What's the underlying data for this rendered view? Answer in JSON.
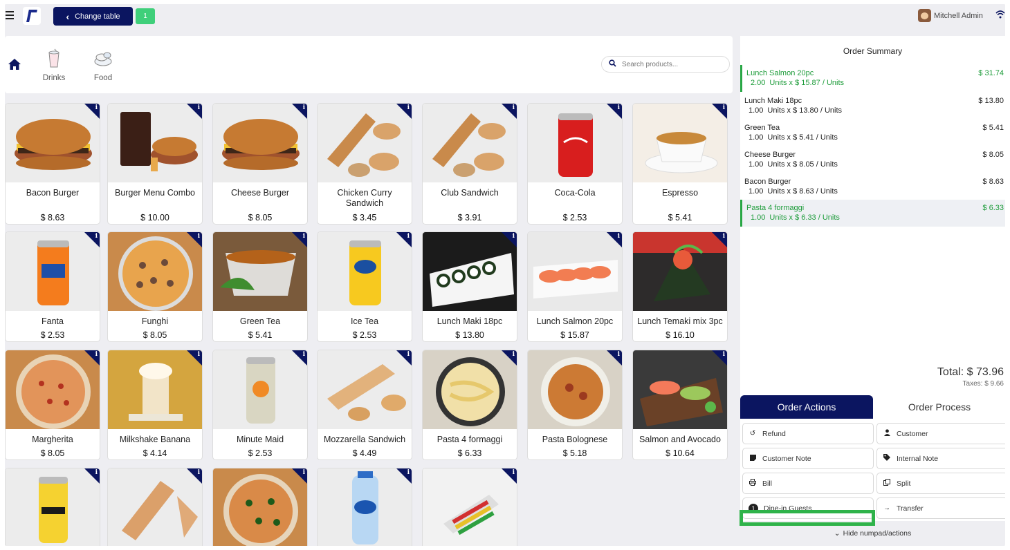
{
  "topbar": {
    "change_table_label": "Change table",
    "table_number": "1",
    "user_name": "Mitchell Admin"
  },
  "categories": [
    {
      "label": "Drinks"
    },
    {
      "label": "Food"
    }
  ],
  "search": {
    "placeholder": "Search products..."
  },
  "products": [
    {
      "name": "Bacon Burger",
      "price": "$ 8.63"
    },
    {
      "name": "Burger Menu Combo",
      "price": "$ 10.00"
    },
    {
      "name": "Cheese Burger",
      "price": "$ 8.05"
    },
    {
      "name": "Chicken Curry Sandwich",
      "price": "$ 3.45"
    },
    {
      "name": "Club Sandwich",
      "price": "$ 3.91"
    },
    {
      "name": "Coca-Cola",
      "price": "$ 2.53"
    },
    {
      "name": "Espresso",
      "price": "$ 5.41"
    },
    {
      "name": "Fanta",
      "price": "$ 2.53"
    },
    {
      "name": "Funghi",
      "price": "$ 8.05"
    },
    {
      "name": "Green Tea",
      "price": "$ 5.41"
    },
    {
      "name": "Ice Tea",
      "price": "$ 2.53"
    },
    {
      "name": "Lunch Maki 18pc",
      "price": "$ 13.80"
    },
    {
      "name": "Lunch Salmon 20pc",
      "price": "$ 15.87"
    },
    {
      "name": "Lunch Temaki mix 3pc",
      "price": "$ 16.10"
    },
    {
      "name": "Margherita",
      "price": "$ 8.05"
    },
    {
      "name": "Milkshake Banana",
      "price": "$ 4.14"
    },
    {
      "name": "Minute Maid",
      "price": "$ 2.53"
    },
    {
      "name": "Mozzarella Sandwich",
      "price": "$ 4.49"
    },
    {
      "name": "Pasta 4 formaggi",
      "price": "$ 6.33"
    },
    {
      "name": "Pasta Bolognese",
      "price": "$ 5.18"
    },
    {
      "name": "Salmon and Avocado",
      "price": "$ 10.64"
    },
    {
      "name": "",
      "price": ""
    },
    {
      "name": "",
      "price": ""
    },
    {
      "name": "",
      "price": ""
    },
    {
      "name": "",
      "price": ""
    },
    {
      "name": "",
      "price": ""
    }
  ],
  "order": {
    "title": "Order Summary",
    "lines": [
      {
        "name": "Lunch Salmon 20pc",
        "price": "$ 31.74",
        "qty": "2.00",
        "detail": "Units x $ 15.87 / Units"
      },
      {
        "name": "Lunch Maki 18pc",
        "price": "$ 13.80",
        "qty": "1.00",
        "detail": "Units x $ 13.80 / Units"
      },
      {
        "name": "Green Tea",
        "price": "$ 5.41",
        "qty": "1.00",
        "detail": "Units x $ 5.41 / Units"
      },
      {
        "name": "Cheese Burger",
        "price": "$ 8.05",
        "qty": "1.00",
        "detail": "Units x $ 8.05 / Units"
      },
      {
        "name": "Bacon Burger",
        "price": "$ 8.63",
        "qty": "1.00",
        "detail": "Units x $ 8.63 / Units"
      },
      {
        "name": "Pasta 4 formaggi",
        "price": "$ 6.33",
        "qty": "1.00",
        "detail": "Units x $ 6.33 / Units"
      }
    ],
    "total": "Total: $ 73.96",
    "taxes": "Taxes: $ 9.66"
  },
  "tabs": {
    "actions": "Order Actions",
    "process": "Order Process"
  },
  "actions": {
    "refund": "Refund",
    "customer": "Customer",
    "customer_note": "Customer Note",
    "internal_note": "Internal Note",
    "bill": "Bill",
    "split": "Split",
    "guests": "Dine-in Guests",
    "guests_count": "1",
    "transfer": "Transfer"
  },
  "hide_numpad": "Hide numpad/actions",
  "colors": {
    "brand": "#0b1560",
    "accent_green": "#28a745",
    "highlight_box": "#2fb34a"
  }
}
